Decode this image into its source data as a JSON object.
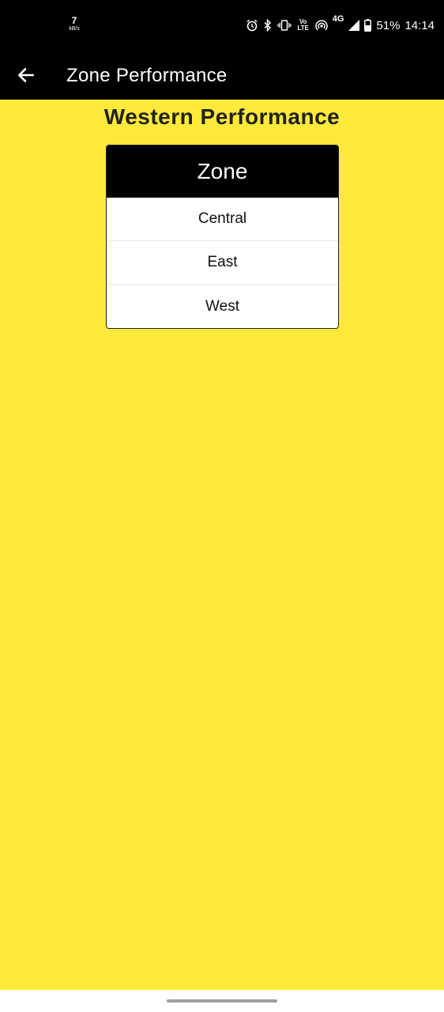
{
  "status_bar": {
    "speed_value": "7",
    "speed_unit": "kB/s",
    "volte_label": "Vo LTE",
    "network_label": "4G",
    "battery_percent": "51%",
    "time": "14:14",
    "icons": [
      "alarm-icon",
      "bluetooth-icon",
      "vibrate-icon",
      "volte-icon",
      "hotspot-icon",
      "signal-icon",
      "battery-icon"
    ]
  },
  "app_bar": {
    "title": "Zone Performance",
    "back_icon": "arrow-left-icon"
  },
  "main": {
    "heading": "Western Performance",
    "table": {
      "header": "Zone",
      "rows": [
        "Central",
        "East",
        "West"
      ]
    }
  },
  "colors": {
    "background": "#ffea3b",
    "bars": "#000000",
    "table_bg": "#ffffff"
  }
}
